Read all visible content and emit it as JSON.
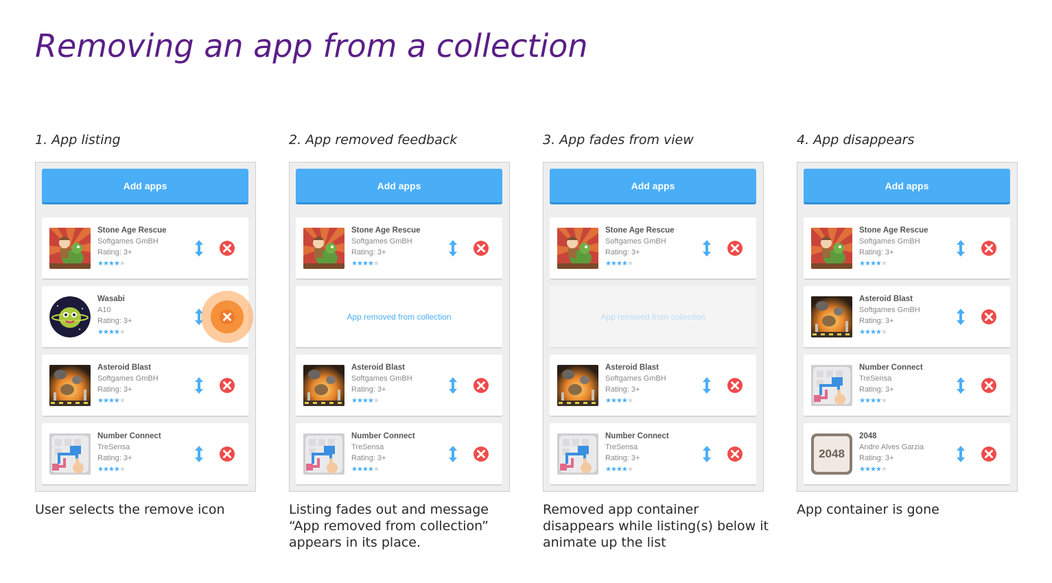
{
  "title": "Removing an app from a collection",
  "add_button_label": "Add apps",
  "removed_message": "App removed from collection",
  "colors": {
    "title": "#5a1e87",
    "accent_blue": "#4aaef7",
    "remove_red": "#ef4b4b",
    "tap_orange": "#f5913a"
  },
  "apps": {
    "stone": {
      "name": "Stone Age Rescue",
      "developer": "Softgames GmBH",
      "rating": "Rating: 3+",
      "stars": 4
    },
    "wasabi": {
      "name": "Wasabi",
      "developer": "A10",
      "rating": "Rating: 3+",
      "stars": 4
    },
    "asteroid": {
      "name": "Asteroid Blast",
      "developer": "Softgames GmBH",
      "rating": "Rating: 3+",
      "stars": 4
    },
    "number": {
      "name": "Number Connect",
      "developer": "TreSensa",
      "rating": "Rating: 3+",
      "stars": 4
    },
    "g2048": {
      "name": "2048",
      "developer": "Andre Alves Garzia",
      "rating": "Rating: 3+",
      "stars": 4,
      "tile_text": "2048"
    }
  },
  "steps": [
    {
      "label": "1. App listing",
      "caption": "User selects the remove icon"
    },
    {
      "label": "2. App removed feedback",
      "caption": "Listing fades out and message “App removed from collection” appears in its place."
    },
    {
      "label": "3. App fades from view",
      "caption": "Removed app container disappears while listing(s) below it animate up the list"
    },
    {
      "label": "4. App disappears",
      "caption": "App container is gone"
    }
  ],
  "icons": {
    "move": "up-down-arrow-icon",
    "remove": "remove-x-circle-icon"
  }
}
